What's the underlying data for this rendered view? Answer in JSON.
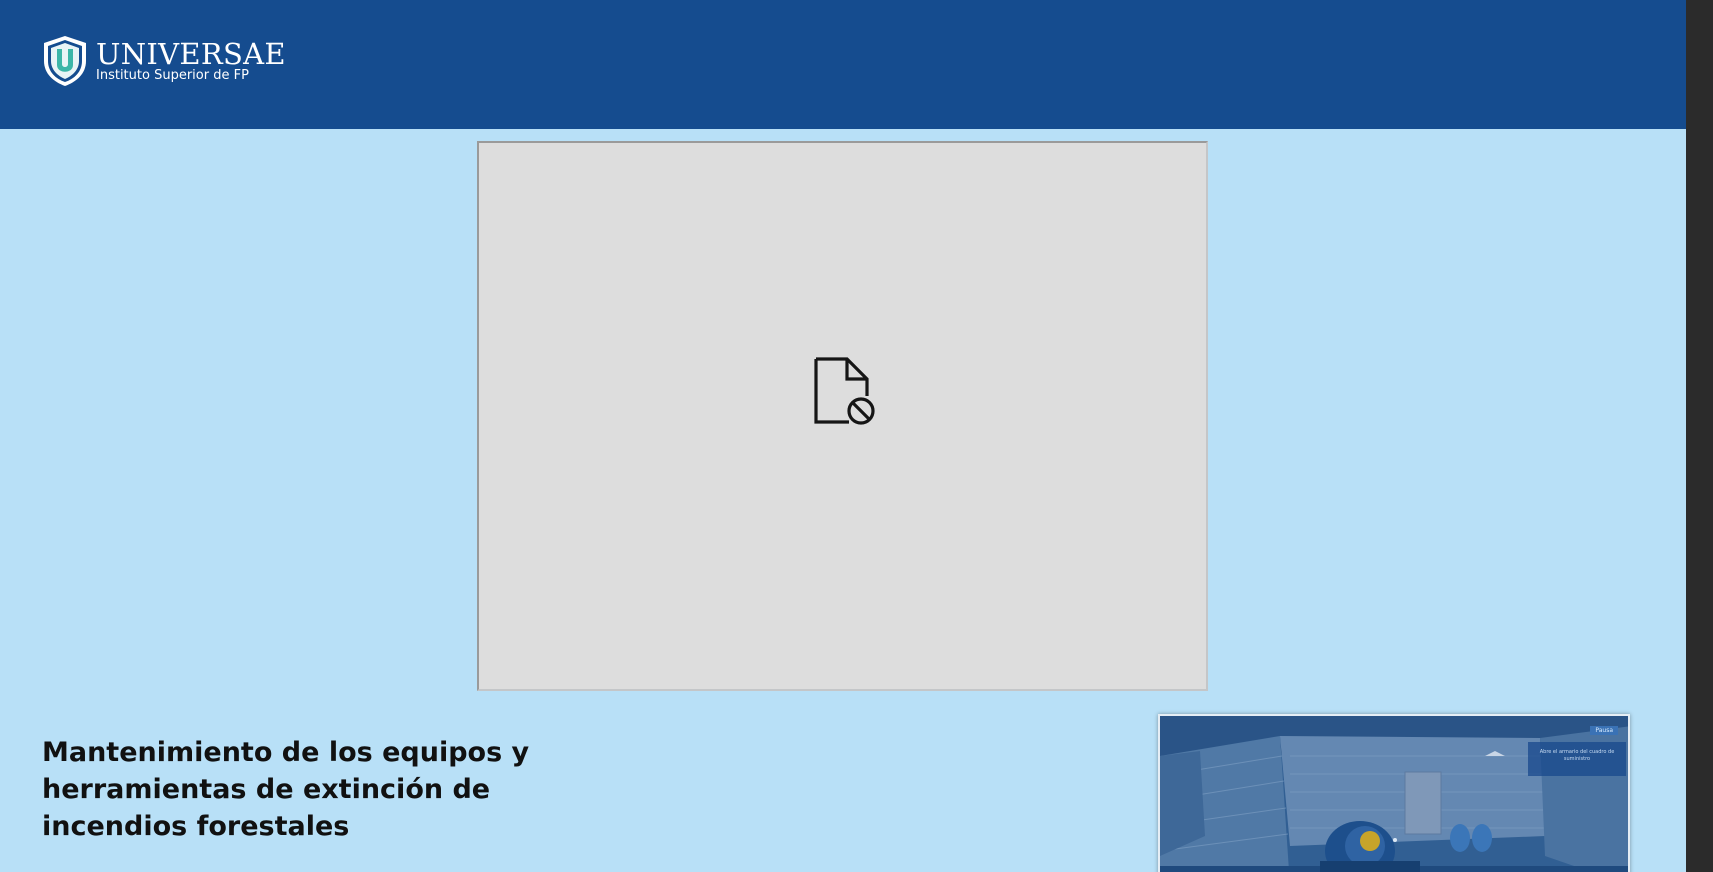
{
  "header": {
    "logo_name": "UNIVERSAE",
    "logo_subtitle": "Instituto Superior de FP",
    "logo_icon": "shield-u-icon",
    "background_color": "#154c8f"
  },
  "embed": {
    "state_icon": "file-blocked-icon",
    "background_color": "#dddddd"
  },
  "course": {
    "title": "Mantenimiento de los equipos y herramientas de extinción de incendios forestales"
  },
  "thumbnail": {
    "badge": "Pausa",
    "panel_text": "Abre el armario del cuadro de suministro"
  },
  "colors": {
    "page_background": "#b8e0f7",
    "title_text": "#111111"
  }
}
